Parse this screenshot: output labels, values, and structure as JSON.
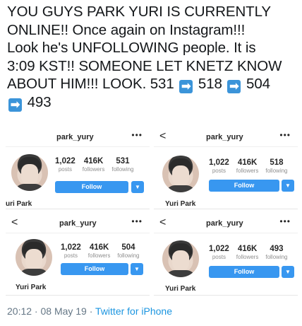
{
  "tweet": {
    "lines": [
      "YOU GUYS PARK YURI IS CURRENTLY",
      "ONLINE!! Once again on Instagram!!!",
      "Look he's UNFOLLOWING people. It is",
      "3:09 KST!! SOMEONE LET KNETZ KNOW"
    ],
    "line5_text": "ABOUT HIM!!! LOOK. 531",
    "seq": [
      "518",
      "504",
      "493"
    ],
    "arrow_icon": "right-arrow-emoji",
    "arrow_color": "#3b94d9"
  },
  "cards": [
    {
      "username": "park_yury",
      "has_back": false,
      "more": "•••",
      "posts": "1,022",
      "followers": "416K",
      "following": "531",
      "posts_label": "posts",
      "followers_label": "followers",
      "following_label": "following",
      "follow_label": "Follow",
      "name": "uri Park"
    },
    {
      "username": "park_yury",
      "has_back": true,
      "back": "<",
      "more": "•••",
      "posts": "1,022",
      "followers": "416K",
      "following": "518",
      "posts_label": "posts",
      "followers_label": "followers",
      "following_label": "following",
      "follow_label": "Follow",
      "name": "Yuri Park"
    },
    {
      "username": "park_yury",
      "has_back": true,
      "back": "<",
      "more": "•••",
      "posts": "1,022",
      "followers": "416K",
      "following": "504",
      "posts_label": "posts",
      "followers_label": "followers",
      "following_label": "following",
      "follow_label": "Follow",
      "name": "Yuri Park"
    },
    {
      "username": "park_yury",
      "has_back": true,
      "back": "<",
      "more": "•••",
      "posts": "1,022",
      "followers": "416K",
      "following": "493",
      "posts_label": "posts",
      "followers_label": "followers",
      "following_label": "following",
      "follow_label": "Follow",
      "name": "Yuri Park"
    }
  ],
  "footer": {
    "time": "20:12 · 08 May 19 · ",
    "source": "Twitter for iPhone"
  },
  "colors": {
    "instagram_blue": "#3897f0",
    "twitter_link": "#1b95e0",
    "muted": "#657786"
  }
}
